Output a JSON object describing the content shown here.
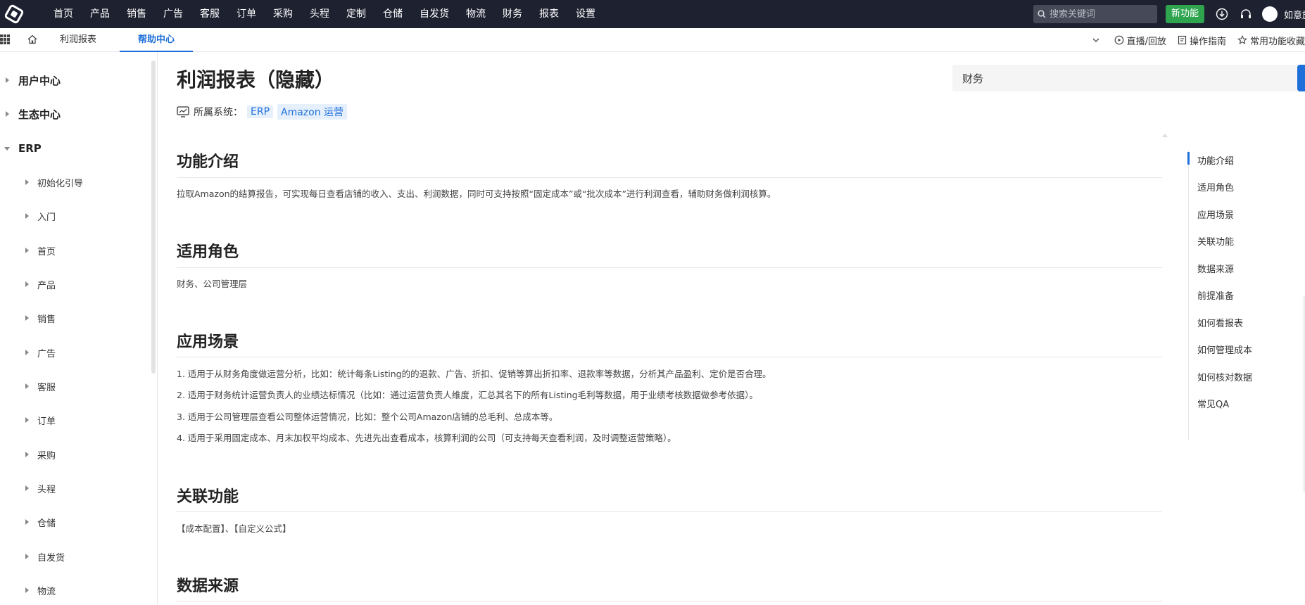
{
  "topnav": {
    "menu": [
      "首页",
      "产品",
      "销售",
      "广告",
      "客服",
      "订单",
      "采购",
      "头程",
      "定制",
      "仓储",
      "自发货",
      "物流",
      "财务",
      "报表",
      "设置"
    ],
    "search_placeholder": "搜索关键词",
    "new_feature": "新功能",
    "user_name": "如意旗舰"
  },
  "tabs": {
    "items": [
      "利润报表",
      "帮助中心"
    ],
    "active_index": 1,
    "live": "直播/回放",
    "guide": "操作指南",
    "favorites": "常用功能收藏"
  },
  "sidebar": {
    "top": [
      "用户中心",
      "生态中心"
    ],
    "erp": "ERP",
    "children": [
      "初始化引导",
      "入门",
      "首页",
      "产品",
      "销售",
      "广告",
      "客服",
      "订单",
      "采购",
      "头程",
      "仓储",
      "自发货",
      "物流"
    ]
  },
  "page": {
    "title": "利润报表（隐藏）",
    "system_label": "所属系统：",
    "system_tags": [
      "ERP",
      "Amazon 运营"
    ],
    "search_value": "财务"
  },
  "sections": {
    "intro": {
      "title": "功能介绍",
      "text": "拉取Amazon的结算报告，可实现每日查看店铺的收入、支出、利润数据，同时可支持按照“固定成本”或“批次成本”进行利润查看，辅助财务做利润核算。"
    },
    "roles": {
      "title": "适用角色",
      "text": "财务、公司管理层"
    },
    "scenes": {
      "title": "应用场景",
      "items": [
        "1. 适用于从财务角度做运营分析，比如：统计每条Listing的的退款、广告、折扣、促销等算出折扣率、退款率等数据，分析其产品盈利、定价是否合理。",
        "2. 适用于财务统计运营负责人的业绩达标情况（比如：通过运营负责人维度，汇总其名下的所有Listing毛利等数据，用于业绩考核数据做参考依据）。",
        "3. 适用于公司管理层查看公司整体运营情况，比如：整个公司Amazon店铺的总毛利、总成本等。",
        "4. 适用于采用固定成本、月末加权平均成本、先进先出查看成本，核算利润的公司（可支持每天查看利润，及时调整运营策略）。"
      ]
    },
    "related": {
      "title": "关联功能",
      "text": "【成本配置】、【自定义公式】"
    },
    "source": {
      "title": "数据来源"
    }
  },
  "toc": [
    "功能介绍",
    "适用角色",
    "应用场景",
    "关联功能",
    "数据来源",
    "前提准备",
    "如何看报表",
    "如何管理成本",
    "如何核对数据",
    "常见QA"
  ],
  "colors": {
    "topbar_bg": "#1e2130",
    "accent": "#1e6fd9",
    "new_btn": "#2ea44f"
  }
}
